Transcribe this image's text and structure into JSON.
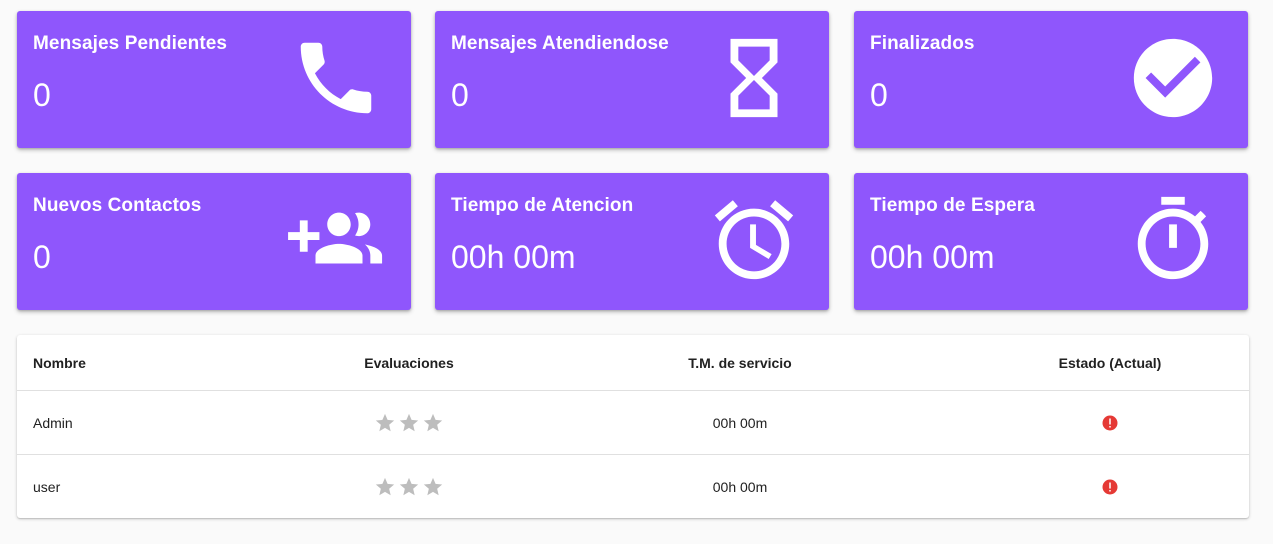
{
  "cards": [
    {
      "title": "Mensajes Pendientes",
      "value": "0",
      "icon": "phone-icon"
    },
    {
      "title": "Mensajes Atendiendose",
      "value": "0",
      "icon": "hourglass-icon"
    },
    {
      "title": "Finalizados",
      "value": "0",
      "icon": "check-circle-icon"
    },
    {
      "title": "Nuevos Contactos",
      "value": "0",
      "icon": "group-add-icon"
    },
    {
      "title": "Tiempo de Atencion",
      "value": "00h 00m",
      "icon": "alarm-icon"
    },
    {
      "title": "Tiempo de Espera",
      "value": "00h 00m",
      "icon": "timer-icon"
    }
  ],
  "colors": {
    "card_bg": "#8f56fc",
    "error": "#e53935",
    "star": "#bdbdbd"
  },
  "table": {
    "headers": {
      "name": "Nombre",
      "ratings": "Evaluaciones",
      "service_time": "T.M. de servicio",
      "status": "Estado (Actual)"
    },
    "rows": [
      {
        "name": "Admin",
        "rating": 0,
        "rating_max": 3,
        "service_time": "00h 00m",
        "status_icon": "error-icon"
      },
      {
        "name": "user",
        "rating": 0,
        "rating_max": 3,
        "service_time": "00h 00m",
        "status_icon": "error-icon"
      }
    ]
  }
}
